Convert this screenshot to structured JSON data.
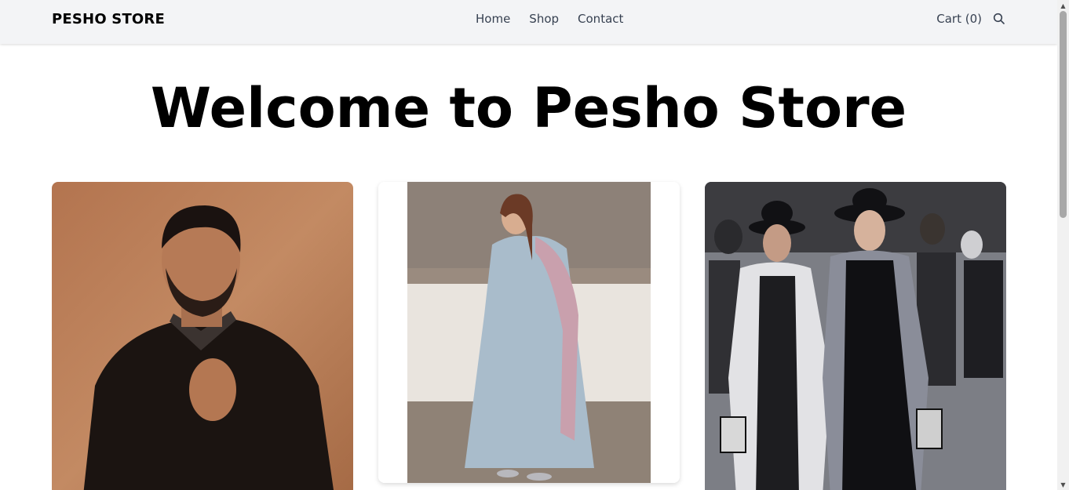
{
  "navbar": {
    "brand": "PESHO STORE",
    "links": [
      "Home",
      "Shop",
      "Contact"
    ],
    "cart_label": "Cart (0)",
    "search_icon": "search-icon"
  },
  "hero": {
    "title": "Welcome to Pesho Store"
  },
  "products": [
    {
      "image": "man-black-shirt-photo"
    },
    {
      "image": "woman-blue-dress-photo"
    },
    {
      "image": "two-women-street-fashion-photo"
    }
  ],
  "colors": {
    "navbar_bg": "#f3f4f6",
    "text": "#000000",
    "link": "#374151"
  }
}
